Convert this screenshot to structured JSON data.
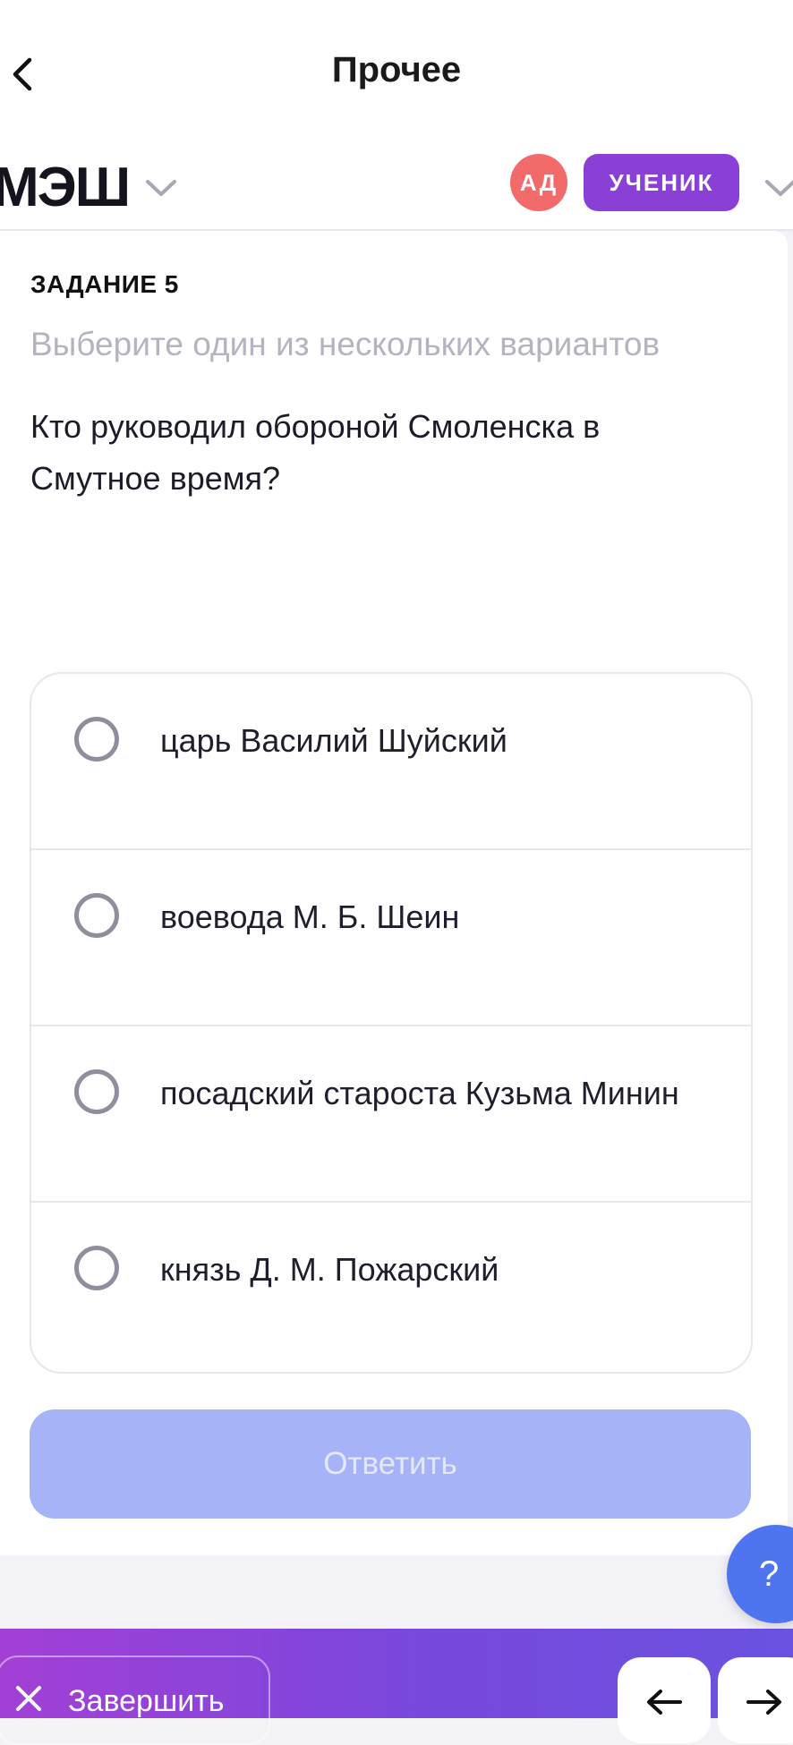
{
  "header": {
    "title": "Прочее"
  },
  "appbar": {
    "logo": "МЭШ",
    "avatar_initials": "АД",
    "role": "УЧЕНИК"
  },
  "task": {
    "label": "ЗАДАНИЕ 5",
    "hint": "Выберите один из нескольких вариантов",
    "question": "Кто руководил обороной Смоленска в Смутное время?",
    "options": [
      {
        "label": "царь Василий Шуйский",
        "selected": false
      },
      {
        "label": "воевода М. Б. Шеин",
        "selected": false
      },
      {
        "label": "посадский староста Кузьма Минин",
        "selected": false
      },
      {
        "label": "князь Д. М. Пожарский",
        "selected": false
      }
    ],
    "submit_label": "Ответить",
    "submit_enabled": false
  },
  "help": {
    "label": "?"
  },
  "footer": {
    "finish_label": "Завершить"
  },
  "colors": {
    "role_badge": "#8a3fd6",
    "avatar": "#f26a6a",
    "submit_disabled": "#a6b4f7",
    "help": "#4e74f0",
    "footer_gradient_start": "#a33fd6",
    "footer_gradient_end": "#6b52e0"
  },
  "icons": {
    "back": "chevron-left-icon",
    "logo_menu": "chevron-down-icon",
    "role_menu": "chevron-down-icon",
    "finish": "close-icon",
    "prev": "arrow-left-icon",
    "next": "arrow-right-icon"
  }
}
